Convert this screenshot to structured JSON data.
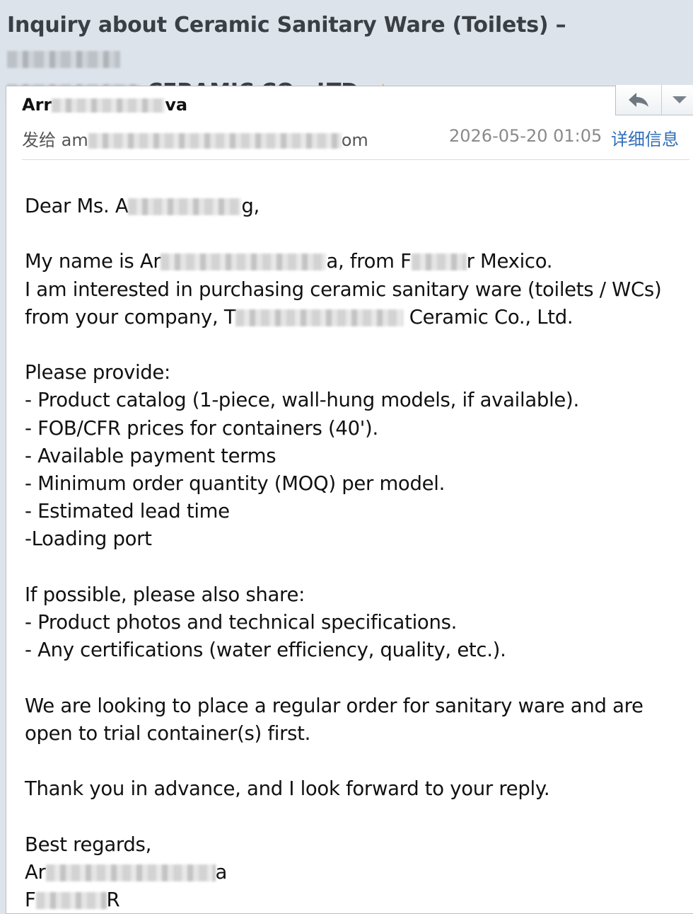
{
  "subject": {
    "line1_start": "Inquiry about Ceramic Sanitary Ware (Toilets) – ",
    "line2_start": "",
    "line2_end": " CERAMIC CO., LTD. ",
    "star": "☆"
  },
  "header": {
    "sender_start": "Arr",
    "sender_end": "va",
    "recipient_prefix": "发给 am",
    "recipient_end": "om",
    "date": "2026-05-20 01:05",
    "details_link": "详细信息"
  },
  "toolbar": {
    "reply_icon": "reply-icon",
    "more_icon": "chevron-down-icon"
  },
  "body": {
    "greeting_start": "Dear Ms. A",
    "greeting_end": "g,",
    "intro_start": "My name is Ar",
    "intro_mid": "a, from F",
    "intro_end": "r Mexico.",
    "interest": "I am interested in purchasing ceramic sanitary ware (toilets / WCs)",
    "company_start": "from your company, T",
    "company_end": " Ceramic Co., Ltd.",
    "provide_heading": "Please provide:",
    "provide_items": [
      "- Product catalog (1-piece, wall-hung models, if available).",
      "- FOB/CFR prices for containers (40').",
      "- Available payment terms",
      "- Minimum order quantity (MOQ) per model.",
      "- Estimated lead time",
      "-Loading port"
    ],
    "share_heading": "If possible, please also share:",
    "share_items": [
      "- Product photos and technical specifications.",
      "- Any certifications (water efficiency, quality, etc.)."
    ],
    "order_line1": "We are looking to place a regular order for sanitary ware and are",
    "order_line2": "open to trial container(s) first.",
    "thanks": "Thank you in advance, and I look forward to your reply.",
    "closing": "Best regards,",
    "sig_name_start": "Ar",
    "sig_name_end": "a",
    "sig_company_start": "F",
    "sig_company_end": "R"
  }
}
